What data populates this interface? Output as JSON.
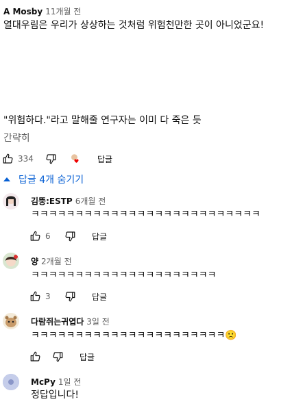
{
  "comment": {
    "author": "A Mosby",
    "time": "11개월 전",
    "text_line1": "열대우림은 우리가 상상하는 것처럼 위험천만한 곳이 아니었군요!",
    "text_line2": "\"위험하다.\"라고 말해줄 연구자는 이미 다 죽은 듯",
    "show_less": "간략히",
    "likes": "334",
    "reply_label": "답글"
  },
  "replies_toggle": "답글 4개 숨기기",
  "replies": [
    {
      "author": "김뚱:ESTP",
      "time": "6개월 전",
      "text": "ㅋㅋㅋㅋㅋㅋㅋㅋㅋㅋㅋㅋㅋㅋㅋㅋㅋㅋㅋㅋㅋㅋㅋㅋㅋㅋ",
      "likes": "6",
      "reply_label": "답글"
    },
    {
      "author": "양",
      "time": "2개월 전",
      "text": "ㅋㅋㅋㅋㅋㅋㅋㅋㅋㅋㅋㅋㅋㅋㅋㅋㅋㅋㅋㅋㅋ",
      "likes": "3",
      "reply_label": "답글"
    },
    {
      "author": "다람쥐는귀엽다",
      "time": "3일 전",
      "text": "ㅋㅋㅋㅋㅋㅋㅋㅋㅋㅋㅋㅋㅋㅋㅋㅋㅋㅋㅋㅋㅋㅋ",
      "emoji": "🙁",
      "likes": "",
      "reply_label": "답글"
    },
    {
      "author": "McPy",
      "time": "1일 전",
      "text": "정답입니다!"
    }
  ]
}
